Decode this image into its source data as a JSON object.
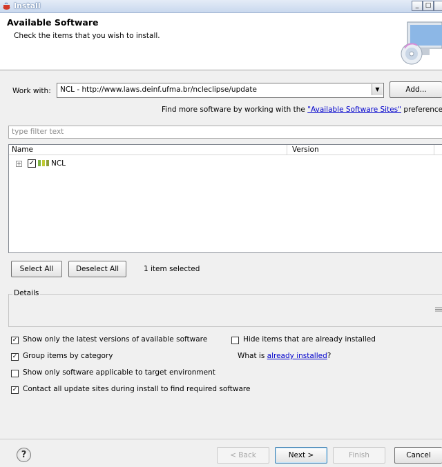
{
  "window": {
    "title": "Install",
    "minimize": "_",
    "maximize": "□"
  },
  "header": {
    "title": "Available Software",
    "description": "Check the items that you wish to install."
  },
  "work_with": {
    "label": "Work with:",
    "value": "NCL - http://www.laws.deinf.ufma.br/ncleclipse/update",
    "add_label": "Add...",
    "find_more_prefix": "Find more software by working with the ",
    "find_more_link": "\"Available Software Sites\"",
    "find_more_suffix": " preferences"
  },
  "filter": {
    "placeholder": "type filter text"
  },
  "tree": {
    "columns": [
      "Name",
      "Version"
    ],
    "rows": [
      {
        "label": "NCL",
        "checked": true,
        "expanded": false
      }
    ]
  },
  "selection": {
    "select_all": "Select All",
    "deselect_all": "Deselect All",
    "status": "1 item selected"
  },
  "details": {
    "label": "Details"
  },
  "options": {
    "latest_versions": {
      "label": "Show only the latest versions of available software",
      "checked": true
    },
    "hide_installed": {
      "label": "Hide items that are already installed",
      "checked": false
    },
    "group_by_category": {
      "label": "Group items by category",
      "checked": true
    },
    "what_is_prefix": "What is ",
    "already_installed_link": "already installed",
    "what_is_suffix": "?",
    "applicable_target": {
      "label": "Show only software applicable to target environment",
      "checked": false
    },
    "contact_sites": {
      "label": "Contact all update sites during install to find required software",
      "checked": true
    }
  },
  "footer": {
    "help": "?",
    "back": "< Back",
    "next": "Next >",
    "finish": "Finish",
    "cancel": "Cancel"
  },
  "colors": {
    "link": "#0000cc",
    "title_bar": "#c9d8ee"
  }
}
